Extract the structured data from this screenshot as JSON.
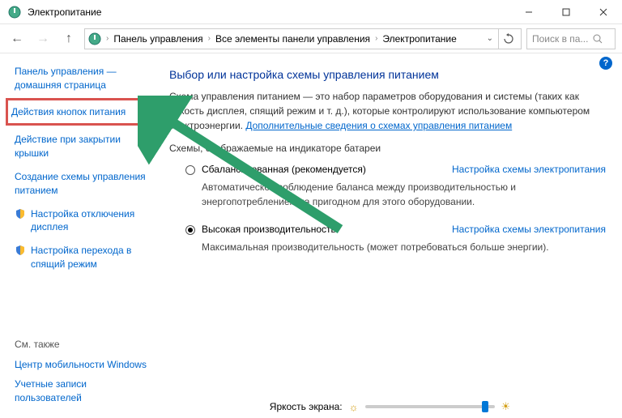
{
  "window": {
    "title": "Электропитание"
  },
  "breadcrumb": {
    "items": [
      "Панель управления",
      "Все элементы панели управления",
      "Электропитание"
    ]
  },
  "search": {
    "placeholder": "Поиск в па..."
  },
  "sidebar": {
    "home": "Панель управления — домашняя страница",
    "links": [
      "Действия кнопок питания",
      "Действие при закрытии крышки",
      "Создание схемы управления питанием",
      "Настройка отключения дисплея",
      "Настройка перехода в спящий режим"
    ],
    "see_also_label": "См. также",
    "see_also": [
      "Центр мобильности Windows",
      "Учетные записи пользователей"
    ]
  },
  "main": {
    "heading": "Выбор или настройка схемы управления питанием",
    "desc_text": "Схема управления питанием — это набор параметров оборудования и системы (таких как яркость дисплея, спящий режим и т. д.), которые контролируют использование компьютером электроэнергии. ",
    "desc_link": "Дополнительные сведения о схемах управления питанием",
    "section_label": "Схемы, отображаемые на индикаторе батареи",
    "plans": [
      {
        "name": "Сбалансированная (рекомендуется)",
        "link": "Настройка схемы электропитания",
        "desc": "Автоматическое соблюдение баланса между производительностью и энергопотреблением на пригодном для этого оборудовании.",
        "checked": false
      },
      {
        "name": "Высокая производительность",
        "link": "Настройка схемы электропитания",
        "desc": "Максимальная производительность (может потребоваться больше энергии).",
        "checked": true
      }
    ],
    "brightness_label": "Яркость экрана:"
  }
}
